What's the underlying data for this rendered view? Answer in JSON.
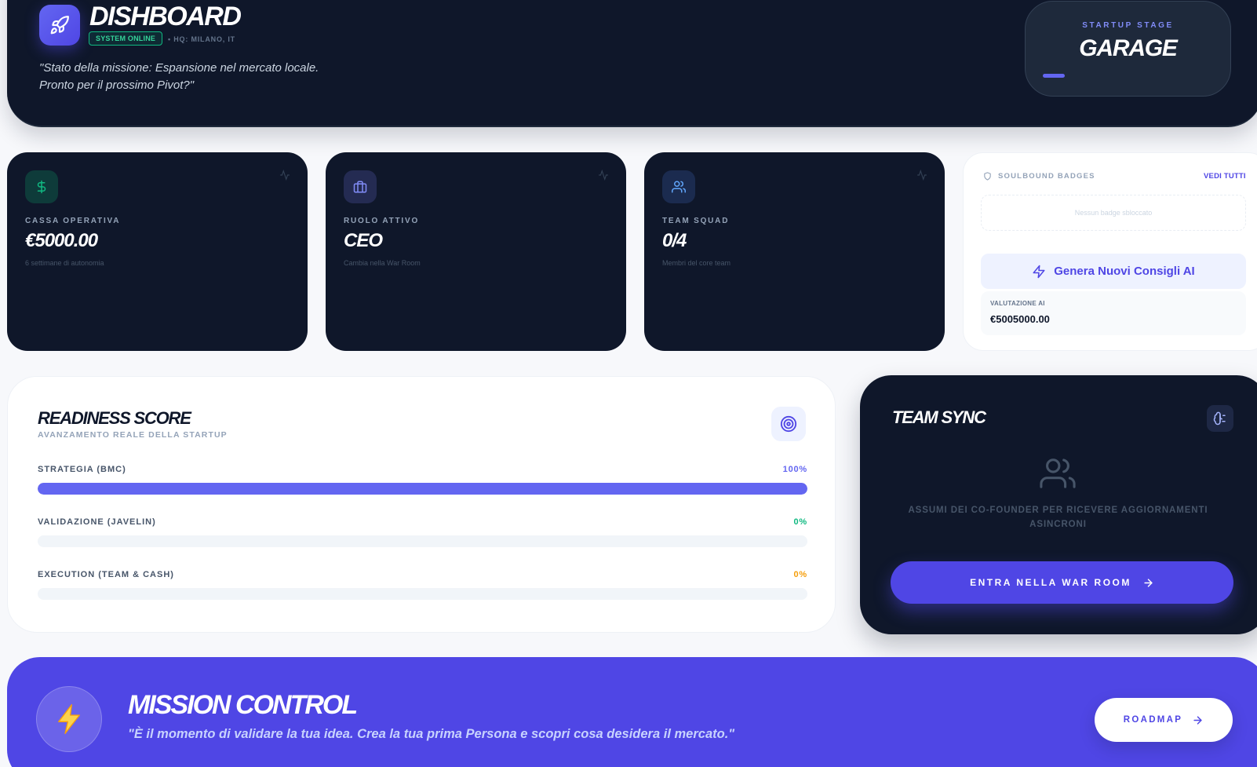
{
  "header": {
    "title": "DISHBOARD",
    "status_badge": "SYSTEM ONLINE",
    "hq": "• HQ: MILANO, IT",
    "mission_line1": "\"Stato della missione: Espansione nel mercato locale.",
    "mission_line2": "Pronto per il prossimo Pivot?\"",
    "logo_icon": "rocket-icon"
  },
  "stage": {
    "label": "STARTUP STAGE",
    "value": "GARAGE",
    "progress": 0.13
  },
  "stats": [
    {
      "label": "CASSA OPERATIVA",
      "value": "€5000.00",
      "sub": "6 settimane di autonomia",
      "icon": "dollar-icon",
      "accent": "#10b981"
    },
    {
      "label": "RUOLO ATTIVO",
      "value": "CEO",
      "sub": "Cambia nella War Room",
      "icon": "briefcase-icon",
      "accent": "#818cf8"
    },
    {
      "label": "TEAM SQUAD",
      "value": "0/4",
      "sub": "Membri del core team",
      "icon": "users-icon",
      "accent": "#60a5fa"
    }
  ],
  "badges": {
    "title": "SOULBOUND BADGES",
    "see_all": "VEDI TUTTI",
    "empty": "Nessun badge sbloccato",
    "ai_button": "Genera Nuovi Consigli AI",
    "valuation_label": "VALUTAZIONE AI",
    "valuation_value": "€5005000.00"
  },
  "readiness": {
    "title": "READINESS SCORE",
    "subtitle": "AVANZAMENTO REALE DELLA STARTUP",
    "items": [
      {
        "label": "STRATEGIA (BMC)",
        "pct_text": "100%",
        "value": 100,
        "color": "#6366f1"
      },
      {
        "label": "VALIDAZIONE (JAVELIN)",
        "pct_text": "0%",
        "value": 0,
        "color": "#10b981"
      },
      {
        "label": "EXECUTION (TEAM & CASH)",
        "pct_text": "0%",
        "value": 0,
        "color": "#f59e0b"
      }
    ]
  },
  "team": {
    "title": "TEAM SYNC",
    "message": "ASSUMI DEI CO-FOUNDER PER RICEVERE AGGIORNAMENTI ASINCRONI",
    "button": "ENTRA NELLA WAR ROOM"
  },
  "mission": {
    "title": "MISSION CONTROL",
    "subtitle": "\"È il momento di validare la tua idea. Crea la tua prima Persona e scopri cosa desidera il mercato.\"",
    "button": "ROADMAP"
  },
  "colors": {
    "brand": "#4f46e5",
    "dark": "#0f172a",
    "success": "#10b981",
    "warning": "#f59e0b"
  }
}
